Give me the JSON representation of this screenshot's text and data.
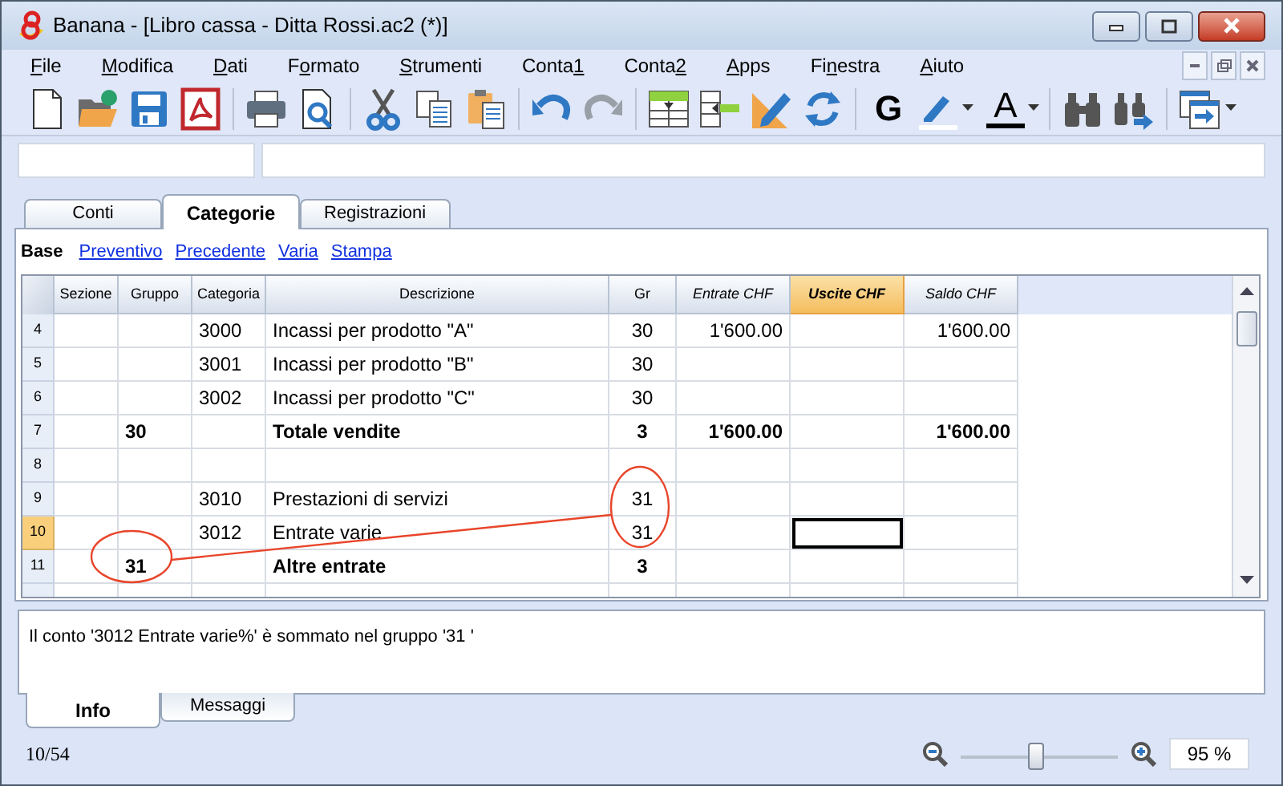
{
  "window": {
    "title": "Banana - [Libro cassa - Ditta Rossi.ac2 (*)]"
  },
  "menu": [
    {
      "key": "F",
      "post": "ile"
    },
    {
      "key": "M",
      "post": "odifica"
    },
    {
      "key": "D",
      "post": "ati"
    },
    {
      "pre": "F",
      "key": "o",
      "post": "rmato"
    },
    {
      "key": "S",
      "post": "trumenti"
    },
    {
      "pre": "Conta",
      "key": "1"
    },
    {
      "pre": "Conta",
      "key": "2"
    },
    {
      "key": "A",
      "post": "pps"
    },
    {
      "pre": "Fi",
      "key": "n",
      "post": "estra"
    },
    {
      "key": "A",
      "post": "iuto"
    }
  ],
  "toolbar": {
    "bold_label": "G",
    "font_color_label": "A"
  },
  "tabs": [
    {
      "label": "Conti",
      "selected": false
    },
    {
      "label": "Categorie",
      "selected": true
    },
    {
      "label": "Registrazioni",
      "selected": false
    }
  ],
  "views": [
    {
      "label": "Base",
      "selected": true
    },
    {
      "label": "Preventivo",
      "selected": false
    },
    {
      "label": "Precedente",
      "selected": false
    },
    {
      "label": "Varia",
      "selected": false
    },
    {
      "label": "Stampa",
      "selected": false
    }
  ],
  "table": {
    "columns": [
      {
        "label": "Sezione",
        "kind": "sezione",
        "selected": false
      },
      {
        "label": "Gruppo",
        "kind": "gruppo",
        "selected": false
      },
      {
        "label": "Categoria",
        "kind": "categoria",
        "selected": false
      },
      {
        "label": "Descrizione",
        "kind": "descrizione",
        "selected": false
      },
      {
        "label": "Gr",
        "kind": "gr",
        "selected": false
      },
      {
        "label": "Entrate CHF",
        "kind": "entrate",
        "selected": false
      },
      {
        "label": "Uscite CHF",
        "kind": "uscite",
        "selected": true
      },
      {
        "label": "Saldo CHF",
        "kind": "saldo",
        "selected": false
      }
    ],
    "rows": [
      {
        "number": "4",
        "kind": "account",
        "selected": false,
        "categoria": "3000",
        "descrizione": "Incassi per prodotto \"A\"",
        "gr": "30",
        "entrate": "1'600.00",
        "saldo": "1'600.00"
      },
      {
        "number": "5",
        "kind": "account",
        "selected": false,
        "categoria": "3001",
        "descrizione": "Incassi per prodotto \"B\"",
        "gr": "30"
      },
      {
        "number": "6",
        "kind": "account",
        "selected": false,
        "categoria": "3002",
        "descrizione": "Incassi per prodotto \"C\"",
        "gr": "30"
      },
      {
        "number": "7",
        "kind": "total",
        "selected": false,
        "gruppo": "30",
        "descrizione": "Totale vendite",
        "gr": "3",
        "entrate": "1'600.00",
        "saldo": "1'600.00"
      },
      {
        "number": "8",
        "kind": "account",
        "selected": false
      },
      {
        "number": "9",
        "kind": "account",
        "selected": false,
        "categoria": "3010",
        "descrizione": "Prestazioni di servizi",
        "gr": "31"
      },
      {
        "number": "10",
        "kind": "account",
        "selected": true,
        "categoria": "3012",
        "descrizione": "Entrate varie",
        "gr": "31"
      },
      {
        "number": "11",
        "kind": "total",
        "selected": false,
        "gruppo": "31",
        "descrizione": "Altre entrate",
        "gr": "3"
      }
    ]
  },
  "info": {
    "message": "Il conto '3012 Entrate varie%' è sommato nel gruppo '31 '"
  },
  "bottom_tabs": [
    {
      "label": "Info",
      "selected": true
    },
    {
      "label": "Messaggi",
      "selected": false
    }
  ],
  "status_bar": {
    "position": "10/54",
    "zoom": {
      "level": 0.48,
      "value": "95 %"
    }
  }
}
